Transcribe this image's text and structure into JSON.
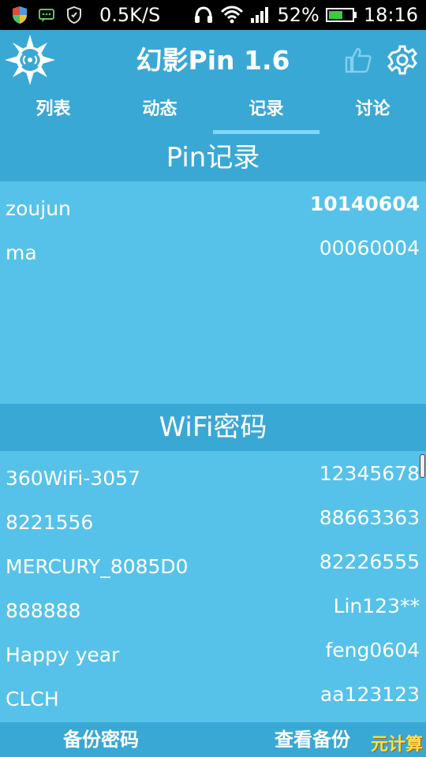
{
  "status_bar": {
    "net_speed": "0.5K/S",
    "battery": "52%",
    "time": "18:16"
  },
  "header": {
    "title": "幻影Pin 1.6"
  },
  "tabs": [
    "列表",
    "动态",
    "记录",
    "讨论"
  ],
  "pin_section": {
    "title": "Pin记录",
    "rows": [
      {
        "name": "zoujun",
        "value": "10140604"
      },
      {
        "name": "ma",
        "value": "00060004"
      }
    ]
  },
  "wifi_section": {
    "title": "WiFi密码",
    "rows": [
      {
        "name": "360WiFi-3057",
        "value": "12345678"
      },
      {
        "name": "8221556",
        "value": "88663363"
      },
      {
        "name": "MERCURY_8085D0",
        "value": "82226555"
      },
      {
        "name": "888888",
        "value": "Lin123**"
      },
      {
        "name": "Happy year",
        "value": "feng0604"
      },
      {
        "name": "CLCH",
        "value": "aa123123"
      }
    ]
  },
  "bottom_bar": {
    "backup_label": "备份密码",
    "view_backup_label": "查看备份",
    "watermark": "元计算"
  },
  "colors": {
    "header_bg": "#3aa8d4",
    "body_bg": "#56c2ea",
    "tab_indicator": "#7fd7f7"
  }
}
